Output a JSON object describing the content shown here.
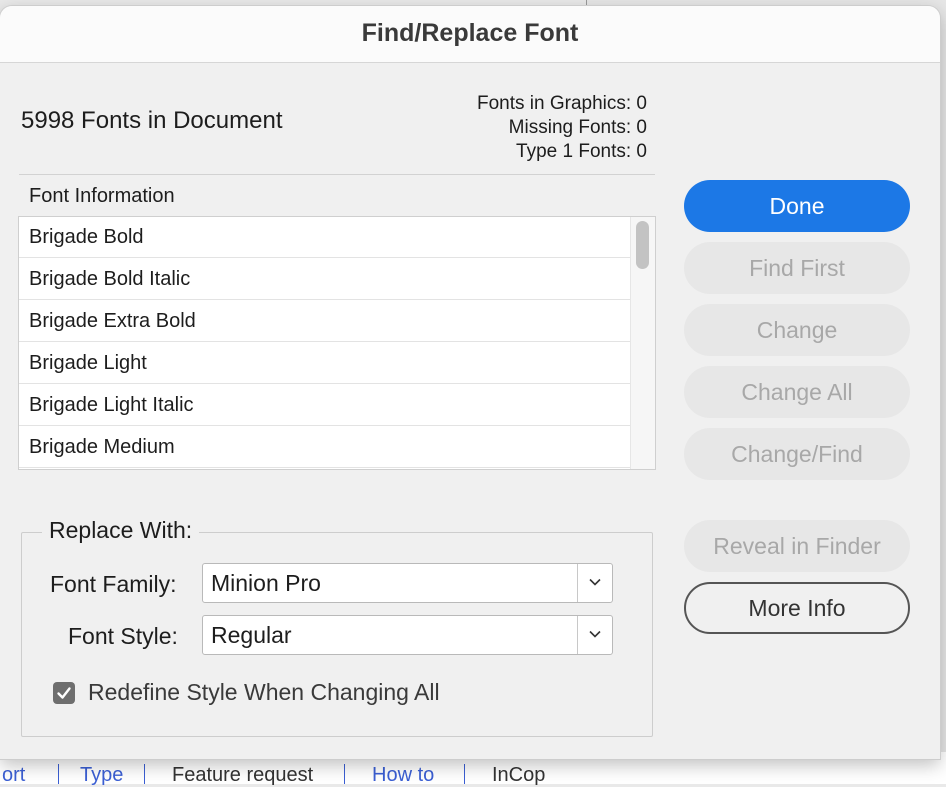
{
  "dialog": {
    "title": "Find/Replace Font",
    "fonts_count_label": "5998 Fonts in Document",
    "stats": {
      "graphics": "Fonts in Graphics: 0",
      "missing": "Missing Fonts: 0",
      "type1": "Type 1 Fonts: 0"
    },
    "font_info_label": "Font Information",
    "fonts": [
      "Brigade Bold",
      "Brigade Bold Italic",
      "Brigade Extra Bold",
      "Brigade Light",
      "Brigade Light Italic",
      "Brigade Medium"
    ],
    "buttons": {
      "done": "Done",
      "find_first": "Find First",
      "change": "Change",
      "change_all": "Change All",
      "change_find": "Change/Find",
      "reveal": "Reveal in Finder",
      "more_info": "More Info"
    },
    "replace": {
      "legend": "Replace With:",
      "family_label": "Font Family:",
      "family_value": "Minion Pro",
      "style_label": "Font Style:",
      "style_value": "Regular",
      "redefine_label": "Redefine Style When Changing All",
      "redefine_checked": true
    }
  },
  "background": {
    "tags": [
      "ort",
      "Type",
      "Feature request",
      "How to",
      "InCop"
    ]
  },
  "colors": {
    "primary": "#1c78e6",
    "disabled_text": "#a8a8a8",
    "link": "#3b5fd4"
  },
  "icons": {
    "dropdown": "chevron-down-icon",
    "checkbox": "checkmark-icon"
  }
}
